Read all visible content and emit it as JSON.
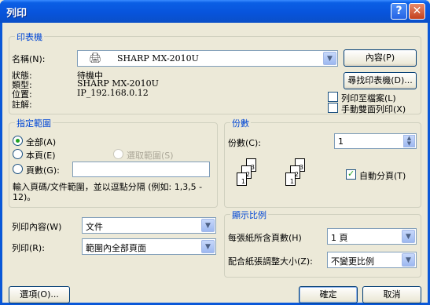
{
  "window": {
    "title": "列印",
    "help_label": "?",
    "close_label": "✕"
  },
  "printer": {
    "group_label": "印表機",
    "name_label": "名稱(N):",
    "name_value": "SHARP MX-2010U",
    "status_label": "狀態:",
    "status_value": "待機中",
    "type_label": "類型:",
    "type_value": "SHARP MX-2010U",
    "where_label": "位置:",
    "where_value": "IP_192.168.0.12",
    "comment_label": "註解:",
    "properties_button": "內容(P)",
    "find_printer_button": "尋找印表機(D)...",
    "print_to_file_label": "列印至檔案(L)",
    "manual_duplex_label": "手動雙面列印(X)"
  },
  "range": {
    "group_label": "指定範圍",
    "all_label": "全部(A)",
    "current_page_label": "本頁(E)",
    "selection_label": "選取範圍(S)",
    "pages_label": "頁數(G):",
    "pages_value": "",
    "hint": "輸入頁碼/文件範圍，並以逗點分隔 (例如: 1,3,5 - 12)。"
  },
  "copies": {
    "group_label": "份數",
    "count_label": "份數(C):",
    "count_value": "1",
    "collate_label": "自動分頁(T)"
  },
  "print_what": {
    "label": "列印內容(W)",
    "value": "文件"
  },
  "print": {
    "label": "列印(R):",
    "value": "範圍內全部頁面"
  },
  "zoom": {
    "group_label": "顯示比例",
    "pages_per_sheet_label": "每張紙所含頁數(H)",
    "pages_per_sheet_value": "1 頁",
    "scale_label": "配合紙張調整大小(Z):",
    "scale_value": "不變更比例"
  },
  "buttons": {
    "options": "選項(O)...",
    "ok": "確定",
    "cancel": "取消"
  }
}
